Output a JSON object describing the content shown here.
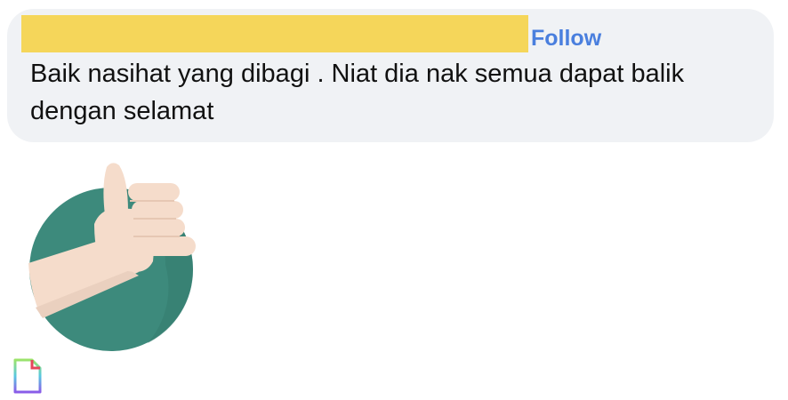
{
  "comment": {
    "follow_label": "Follow",
    "text": "Baik nasihat yang dibagi . Niat dia nak semua dapat balik dengan selamat"
  },
  "sticker": {
    "icon": "thumbs-up-sticker"
  },
  "attachment": {
    "icon": "file-icon"
  },
  "colors": {
    "bubble_bg": "#f0f2f5",
    "redaction": "#f5d65a",
    "follow": "#4a7fde",
    "sticker_circle": "#3d8a7c",
    "sticker_hand": "#f5dccb"
  }
}
